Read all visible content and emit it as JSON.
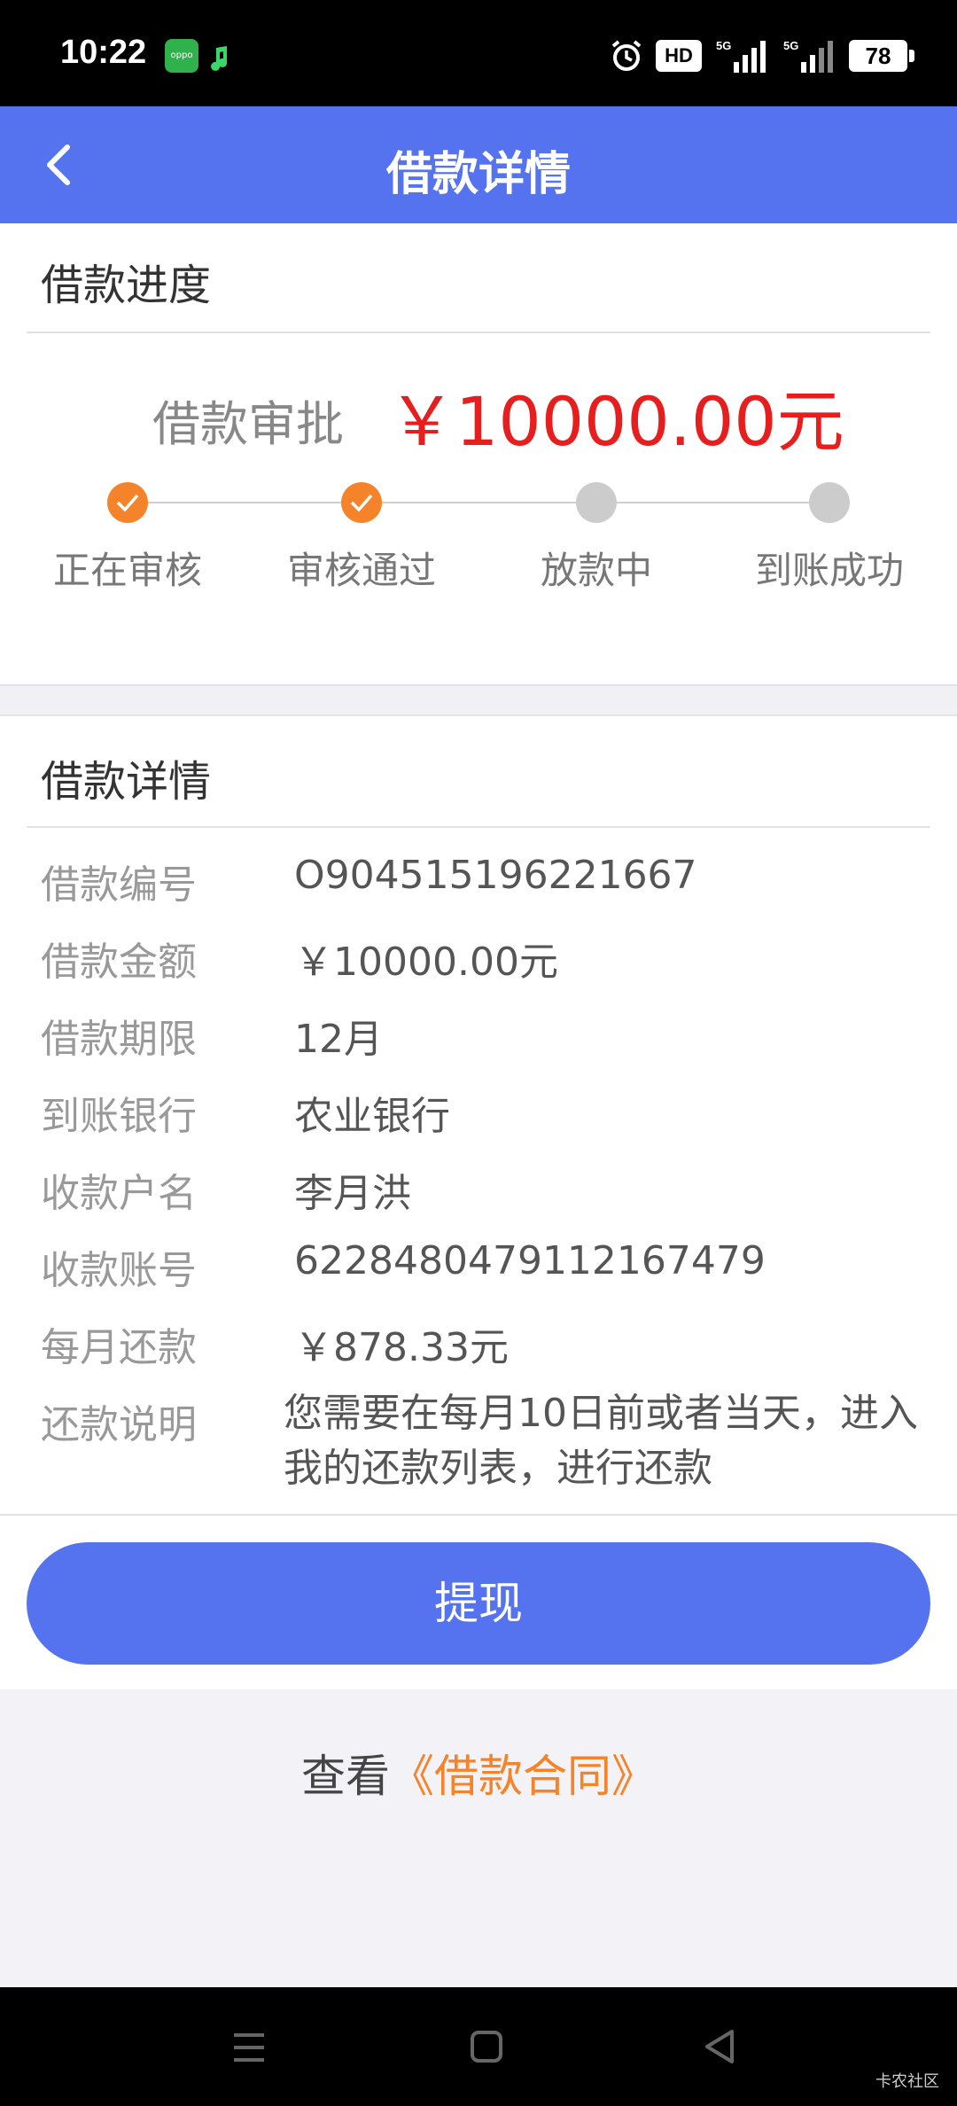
{
  "status_bar": {
    "time": "10:22",
    "hd_label": "HD",
    "battery": "78"
  },
  "header": {
    "title": "借款详情"
  },
  "progress": {
    "section_title": "借款进度",
    "approval_label": "借款审批",
    "approval_amount": "￥10000.00元",
    "steps": [
      {
        "label": "正在审核",
        "done": true
      },
      {
        "label": "审核通过",
        "done": true
      },
      {
        "label": "放款中",
        "done": false
      },
      {
        "label": "到账成功",
        "done": false
      }
    ],
    "accent_color": "#f5832a"
  },
  "details": {
    "section_title": "借款详情",
    "rows": [
      {
        "label": "借款编号",
        "value": "O904515196221667"
      },
      {
        "label": "借款金额",
        "value": "￥10000.00元"
      },
      {
        "label": "借款期限",
        "value": "12月"
      },
      {
        "label": "到账银行",
        "value": "农业银行"
      },
      {
        "label": "收款户名",
        "value": "李月洪"
      },
      {
        "label": "收款账号",
        "value": "6228480479112167479"
      },
      {
        "label": "每月还款",
        "value": "￥878.33元"
      }
    ],
    "note_label": "还款说明",
    "note_value": "您需要在每月10日前或者当天，进入我的还款列表，进行还款"
  },
  "actions": {
    "withdraw_label": "提现",
    "contract_prefix": "查看",
    "contract_link": "《借款合同》"
  },
  "nav_bar": {
    "watermark": "卡农社区"
  },
  "colors": {
    "primary": "#5573ee",
    "amount_red": "#e61e1e",
    "orange": "#f5832a"
  }
}
